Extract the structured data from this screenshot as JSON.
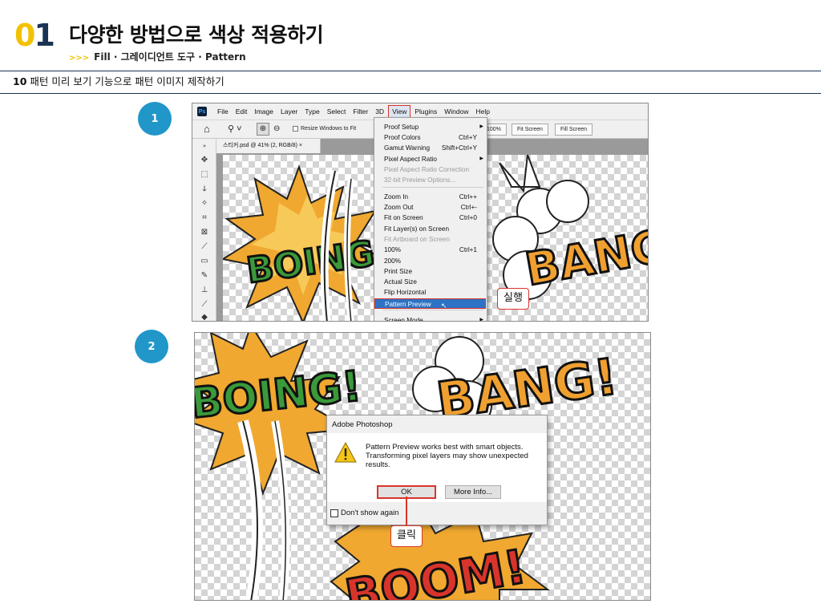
{
  "header": {
    "chapter_num_0": "0",
    "chapter_num_1": "1",
    "title": "다양한 방법으로 색상 적용하기",
    "sub_arrows": ">>>",
    "subtitle": "Fill · 그레이디언트 도구 · Pattern"
  },
  "section": {
    "number": "10",
    "title": "패턴 미리 보기 기능으로 패턴 이미지 제작하기"
  },
  "steps": [
    "1",
    "2"
  ],
  "shot1": {
    "app_badge": "Ps",
    "menubar": [
      "File",
      "Edit",
      "Image",
      "Layer",
      "Type",
      "Select",
      "Filter",
      "3D",
      "View",
      "Plugins",
      "Window",
      "Help"
    ],
    "active_menu": "View",
    "options": {
      "resize_windows": "Resize Windows to Fit",
      "zoom_pct": "100%",
      "fit_screen": "Fit Screen",
      "fill_screen": "Fill Screen"
    },
    "doc_tab": "스티커.psd @ 41% (2, RGB/8)",
    "doc_tab_close": "×",
    "view_menu": [
      {
        "label": "Proof Setup",
        "shortcut": "",
        "sub": "▶"
      },
      {
        "label": "Proof Colors",
        "shortcut": "Ctrl+Y"
      },
      {
        "label": "Gamut Warning",
        "shortcut": "Shift+Ctrl+Y"
      },
      {
        "label": "Pixel Aspect Ratio",
        "shortcut": "",
        "sub": "▶"
      },
      {
        "label": "Pixel Aspect Ratio Correction",
        "shortcut": "",
        "disabled": true
      },
      {
        "label": "32-bit Preview Options...",
        "shortcut": "",
        "disabled": true
      },
      {
        "label": "Zoom In",
        "shortcut": "Ctrl++"
      },
      {
        "label": "Zoom Out",
        "shortcut": "Ctrl+-"
      },
      {
        "label": "Fit on Screen",
        "shortcut": "Ctrl+0"
      },
      {
        "label": "Fit Layer(s) on Screen",
        "shortcut": ""
      },
      {
        "label": "Fit Artboard on Screen",
        "shortcut": "",
        "disabled": true
      },
      {
        "label": "100%",
        "shortcut": "Ctrl+1"
      },
      {
        "label": "200%",
        "shortcut": ""
      },
      {
        "label": "Print Size",
        "shortcut": ""
      },
      {
        "label": "Actual Size",
        "shortcut": ""
      },
      {
        "label": "Flip Horizontal",
        "shortcut": ""
      },
      {
        "label": "Pattern Preview",
        "shortcut": "",
        "selected": true
      },
      {
        "label": "Screen Mode",
        "shortcut": "",
        "sub": "▶"
      }
    ],
    "callout": "실행",
    "art": {
      "boing": "BOING",
      "bang": "BANG!"
    }
  },
  "shot2": {
    "dialog": {
      "title": "Adobe Photoshop",
      "message": "Pattern Preview works best with smart objects. Transforming pixel layers may show unexpected results.",
      "ok": "OK",
      "more_info": "More Info...",
      "dont_show": "Don't show again"
    },
    "callout": "클릭",
    "art": {
      "boing": "BOING!",
      "bang": "BANG!",
      "boom": "BOOM!"
    }
  },
  "colors": {
    "accent_yellow": "#f2c200",
    "navy": "#1b3353",
    "step_blue": "#2196c9",
    "highlight_red": "#d9342b",
    "menu_select": "#2d72c4"
  }
}
